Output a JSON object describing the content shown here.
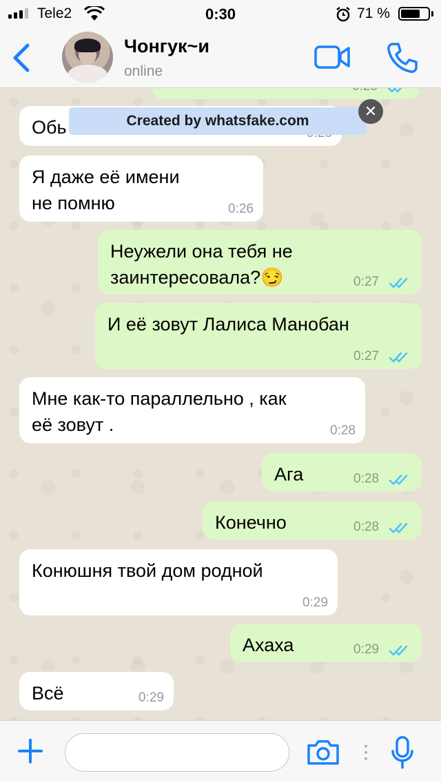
{
  "status_bar": {
    "carrier": "Tele2",
    "time": "0:30",
    "battery_percent_label": "71 %",
    "battery_level": 0.71
  },
  "header": {
    "contact_name": "Чонгук~и",
    "contact_status": "online",
    "icons": [
      "back-chevron-icon",
      "video-call-icon",
      "phone-call-icon"
    ]
  },
  "watermark": {
    "text": "Created by whatsfake.com"
  },
  "messages": [
    {
      "dir": "out",
      "text": "",
      "time": "0:25"
    },
    {
      "dir": "in",
      "text": "Обь",
      "time": "0:25"
    },
    {
      "dir": "in",
      "text": "Я даже её имени\nне помню",
      "time": "0:26"
    },
    {
      "dir": "out",
      "text": "Неужели она тебя не\nзаинтересовала?😏",
      "time": "0:27"
    },
    {
      "dir": "out",
      "text": "И её зовут Лалиса Манобан",
      "time": "0:27"
    },
    {
      "dir": "in",
      "text": "Мне как-то параллельно , как\nеё зовут .",
      "time": "0:28"
    },
    {
      "dir": "out",
      "text": "Ага",
      "time": "0:28"
    },
    {
      "dir": "out",
      "text": "Конечно",
      "time": "0:28"
    },
    {
      "dir": "in",
      "text": "Конюшня твой дом родной",
      "time": "0:29"
    },
    {
      "dir": "out",
      "text": "Ахаха",
      "time": "0:29"
    },
    {
      "dir": "in",
      "text": "Всё",
      "time": "0:29"
    }
  ],
  "input_bar": {
    "icons": [
      "plus-icon",
      "camera-icon",
      "microphone-icon"
    ]
  },
  "colors": {
    "accent": "#1a82fb",
    "outgoing_bubble": "#dcf8c6",
    "incoming_bubble": "#ffffff",
    "read_ticks": "#4fc3f7"
  }
}
